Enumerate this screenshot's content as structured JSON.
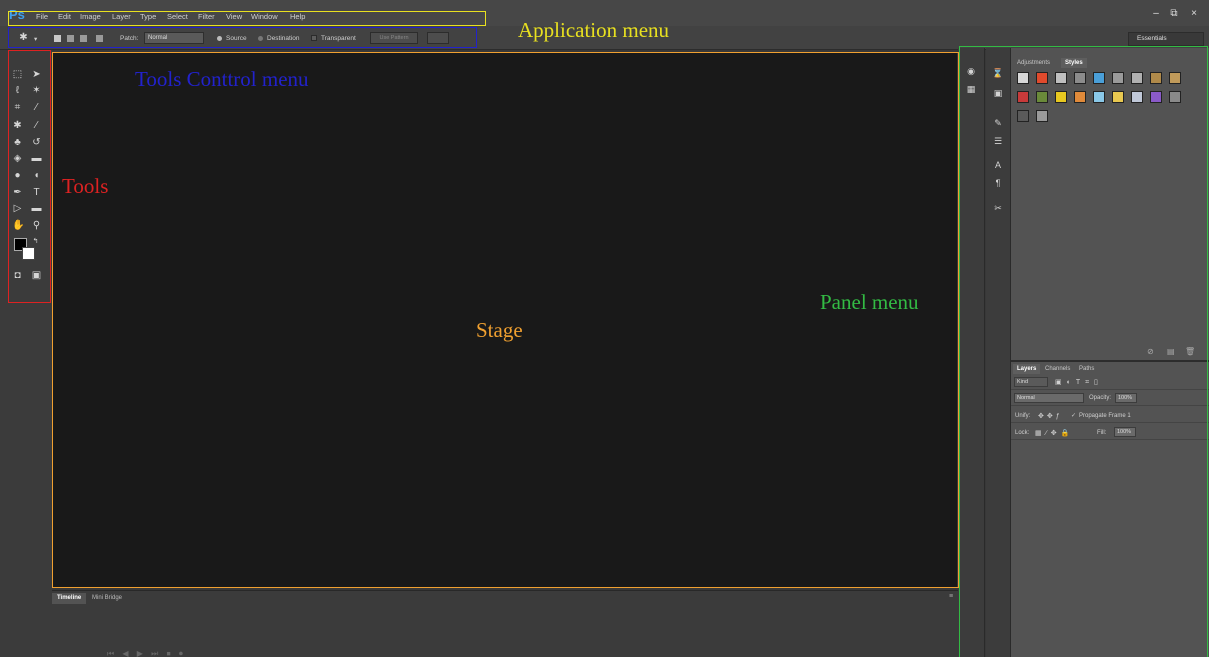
{
  "app": {
    "logo": "Ps"
  },
  "menu": [
    "File",
    "Edit",
    "Image",
    "Layer",
    "Type",
    "Select",
    "Filter",
    "View",
    "Window",
    "Help"
  ],
  "window_buttons": [
    "–",
    "⧉",
    "×"
  ],
  "options_bar": {
    "patch_label": "Patch:",
    "patch_mode": "Normal",
    "source_label": "Source",
    "destination_label": "Destination",
    "transparent_label": "Transparent",
    "use_pattern_label": "Use Pattern"
  },
  "workspace": {
    "selected": "Essentials"
  },
  "bottom_panel": {
    "tabs": [
      "Timeline",
      "Mini Bridge"
    ]
  },
  "adjustments_panel": {
    "tabs": [
      "Adjustments",
      "Styles"
    ],
    "active_tab": "Styles"
  },
  "styles_swatches": [
    "#d8d8d8",
    "#e04a2c",
    "#bfbfbf",
    "#8c8c8c",
    "#4a9fd8",
    "#9a9a9a",
    "#b0b0b0",
    "#b08a4a",
    "#c09a5a",
    "#c83a3a",
    "#6a8a3a",
    "#e8c820",
    "#e08a3a",
    "#8ac8e8",
    "#e8c850",
    "#c0c8d8",
    "#8a5ac8",
    "#8a8a8a",
    "#5a5a5a",
    "#9a9a9a"
  ],
  "layers_panel": {
    "tabs": [
      "Layers",
      "Channels",
      "Paths"
    ],
    "active_tab": "Layers",
    "kind_label": "Kind",
    "blend_mode": "Normal",
    "opacity_label": "Opacity:",
    "opacity_value": "100%",
    "unify_label": "Unify:",
    "propagate_label": "Propagate Frame 1",
    "lock_label": "Lock:",
    "fill_label": "Fill:",
    "fill_value": "100%"
  },
  "annotations": {
    "application_menu": {
      "label": "Application menu",
      "color": "#e8e020"
    },
    "tools_control_menu": {
      "label": "Tools Conttrol menu",
      "color": "#2222cc"
    },
    "tools": {
      "label": "Tools",
      "color": "#dd2222"
    },
    "stage": {
      "label": "Stage",
      "color": "#f0a030"
    },
    "panel_menu": {
      "label": "Panel menu",
      "color": "#33bb44"
    }
  }
}
